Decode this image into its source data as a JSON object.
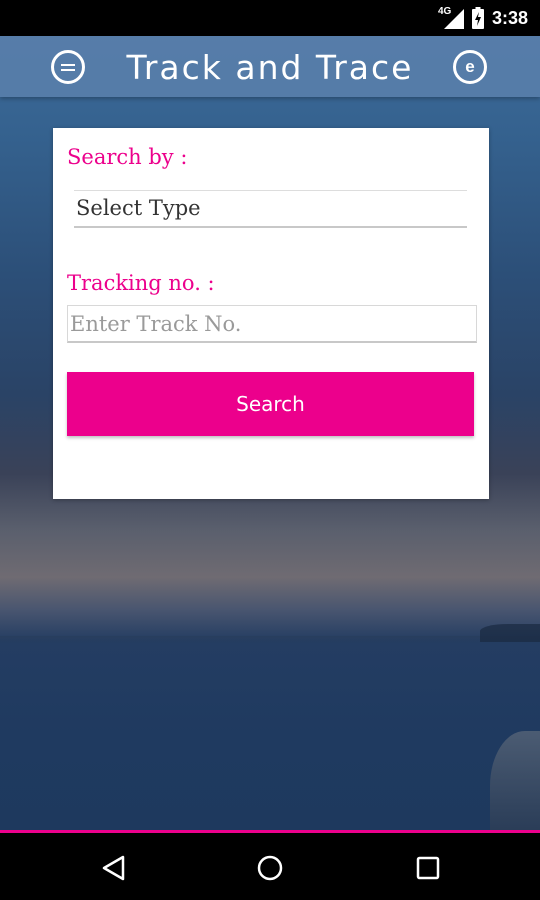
{
  "status_bar": {
    "network": "4G",
    "time": "3:38",
    "icons": [
      "signal-icon",
      "battery-charging-icon"
    ]
  },
  "app_bar": {
    "title": "Track and Trace",
    "left_icon": "menu-icon",
    "right_button_label": "e"
  },
  "form": {
    "search_by_label": "Search by :",
    "select_value": "Select Type",
    "tracking_label": "Tracking no. :",
    "tracking_placeholder": "Enter Track No.",
    "tracking_value": "",
    "search_button": "Search"
  },
  "nav_bar": {
    "icons": [
      "back-icon",
      "home-icon",
      "recent-apps-icon"
    ]
  },
  "colors": {
    "accent": "#ec008c",
    "app_bar": "#5a80ac"
  }
}
